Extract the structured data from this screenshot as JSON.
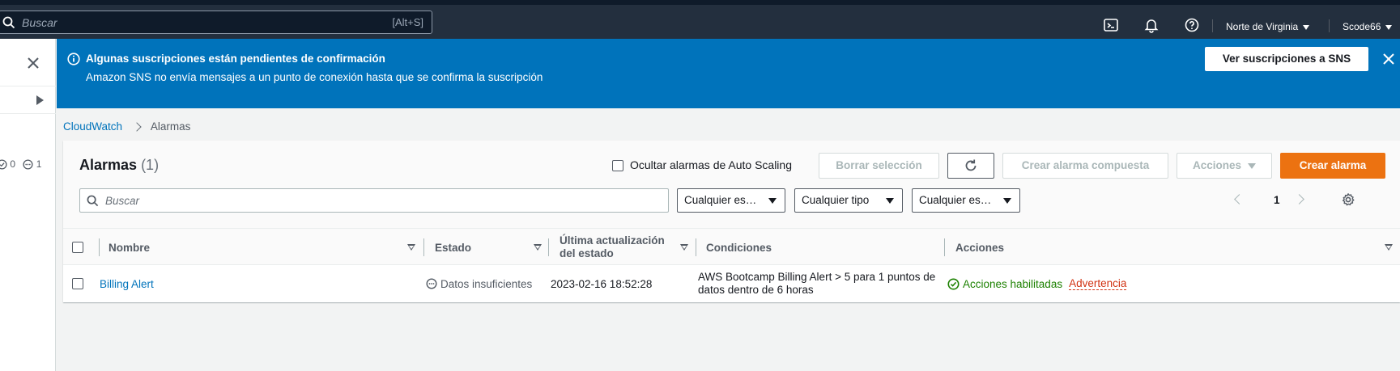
{
  "topnav": {
    "search_placeholder": "Buscar",
    "search_shortcut": "[Alt+S]",
    "region": "Norte de Virginia",
    "account": "Scode66",
    "icons": [
      "cloudshell-icon",
      "bell-icon",
      "help-icon"
    ]
  },
  "leftpanel": {
    "count_ok": "0",
    "count_insufficient": "1"
  },
  "flash": {
    "title": "Algunas suscripciones están pendientes de confirmación",
    "message": "Amazon SNS no envía mensajes a un punto de conexión hasta que se confirma la suscripción",
    "button": "Ver suscripciones a SNS",
    "color": "#0073bb"
  },
  "breadcrumb": {
    "root": "CloudWatch",
    "current": "Alarmas"
  },
  "alarms": {
    "title": "Alarmas",
    "count": "(1)",
    "hide_autoscaling_label": "Ocultar alarmas de Auto Scaling",
    "clear_selection": "Borrar selección",
    "create_composite": "Crear alarma compuesta",
    "actions": "Acciones",
    "create_alarm": "Crear alarma",
    "filter_placeholder": "Buscar",
    "filter_state": "Cualquier es…",
    "filter_type": "Cualquier tipo",
    "filter_status": "Cualquier es…",
    "page": "1",
    "primary_color": "#ec7211"
  },
  "table": {
    "headers": {
      "name": "Nombre",
      "state": "Estado",
      "updated": "Última actualización del estado",
      "conditions": "Condiciones",
      "actions": "Acciones"
    },
    "rows": [
      {
        "name": "Billing Alert",
        "state": "Datos insuficientes",
        "updated": "2023-02-16 18:52:28",
        "conditions": "AWS Bootcamp Billing Alert > 5 para 1 puntos de datos dentro de 6 horas",
        "actions_enabled": "Acciones habilitadas",
        "actions_warning": "Advertencia"
      }
    ]
  }
}
